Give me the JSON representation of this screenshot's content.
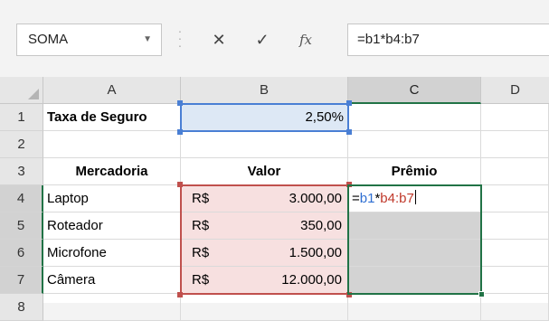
{
  "name_box": {
    "value": "SOMA"
  },
  "formula_bar": {
    "cancel_symbol": "✕",
    "enter_symbol": "✓",
    "fx_label": "fx",
    "formula": "=b1*b4:b7"
  },
  "columns": [
    "A",
    "B",
    "C",
    "D"
  ],
  "rows": [
    "1",
    "2",
    "3",
    "4",
    "5",
    "6",
    "7",
    "8"
  ],
  "cells": {
    "A1": "Taxa de Seguro",
    "B1": "2,50%",
    "A3": "Mercadoria",
    "B3": "Valor",
    "C3": "Prêmio",
    "A4": "Laptop",
    "A5": "Roteador",
    "A6": "Microfone",
    "A7": "Câmera",
    "B4_cur": "R$",
    "B4": "3.000,00",
    "B5_cur": "R$",
    "B5": "350,00",
    "B6_cur": "R$",
    "B6": "1.500,00",
    "B7_cur": "R$",
    "B7": "12.000,00",
    "C4_eq": "=",
    "C4_ref1": "b1",
    "C4_op": "*",
    "C4_ref2": "b4:b7"
  },
  "colors": {
    "ref_blue": "#4a7fd4",
    "ref_red": "#c0504d",
    "selection_green": "#217346"
  }
}
